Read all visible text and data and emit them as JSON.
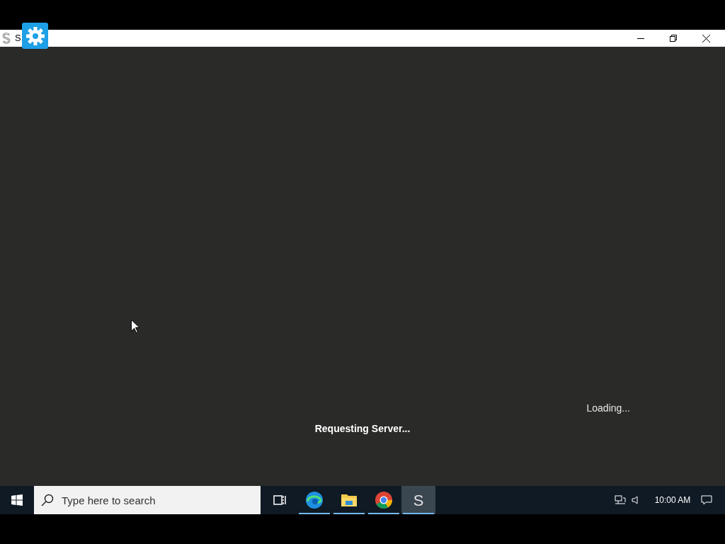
{
  "window": {
    "title": "S"
  },
  "content": {
    "status": "Requesting Server...",
    "loading": "Loading..."
  },
  "taskbar": {
    "search": {
      "placeholder": "Type here to search"
    },
    "apps": [
      {
        "kind": "task-view",
        "running": false,
        "selected": false
      },
      {
        "kind": "edge",
        "running": true,
        "selected": false
      },
      {
        "kind": "explorer",
        "running": true,
        "selected": false
      },
      {
        "kind": "chrome",
        "running": true,
        "selected": false
      },
      {
        "kind": "s-app",
        "label": "S",
        "running": true,
        "selected": true
      }
    ],
    "clock": {
      "time": "10:00 AM"
    }
  }
}
